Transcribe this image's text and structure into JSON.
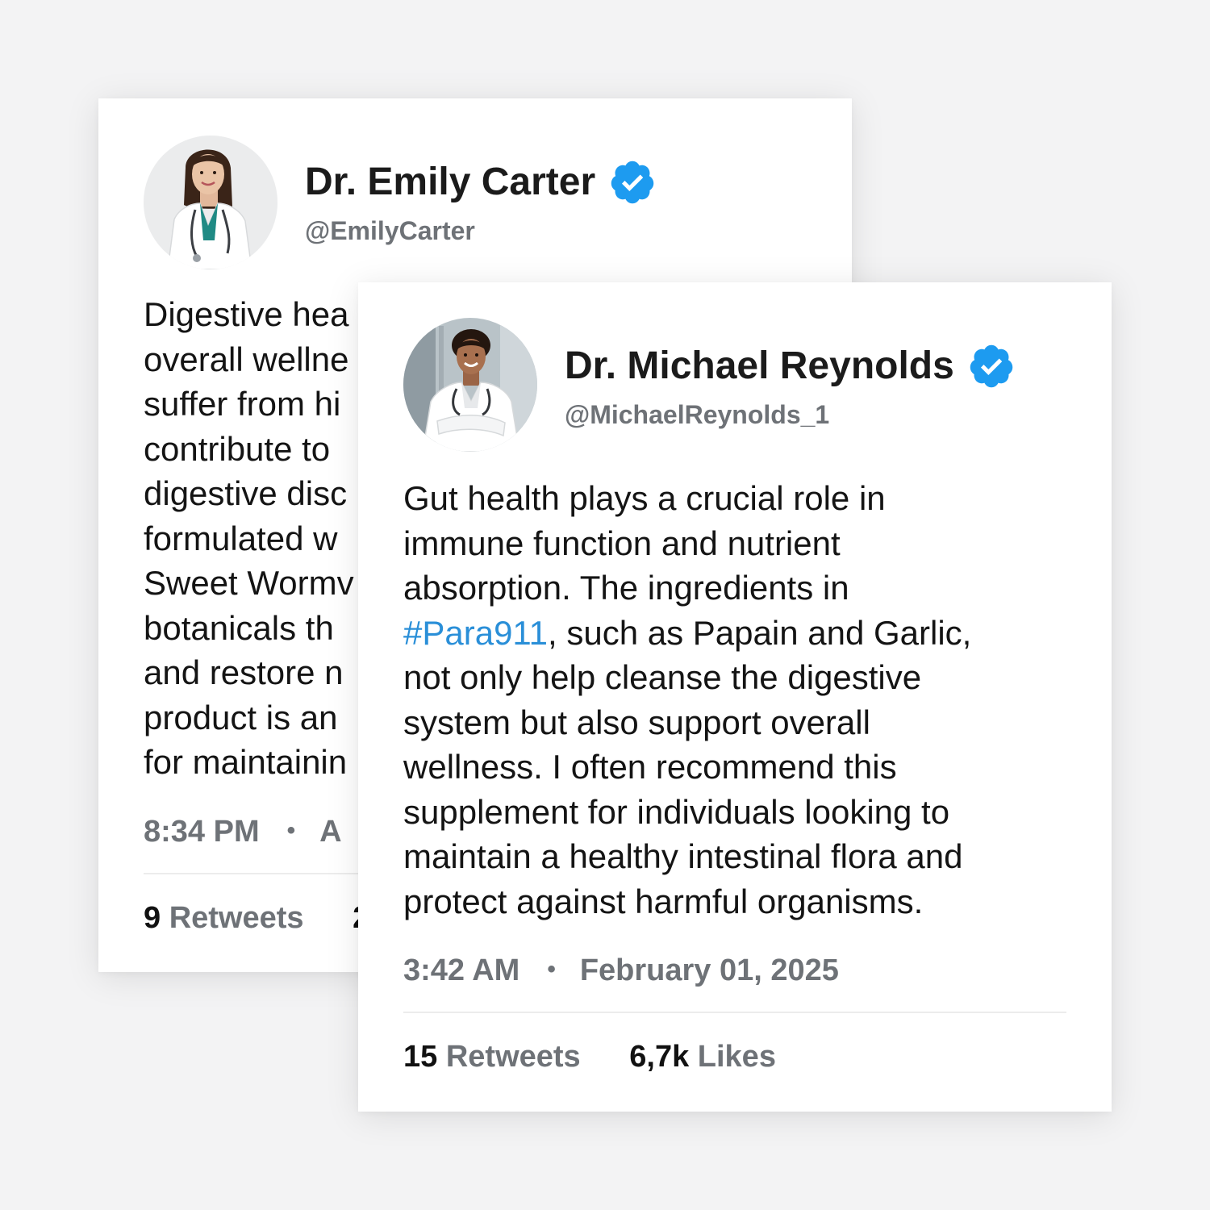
{
  "accent_color": "#2a8fd8",
  "verified_color": "#1d9bf0",
  "posts": [
    {
      "author": {
        "name": "Dr. Emily Carter",
        "handle": "@EmilyCarter",
        "verified": true,
        "avatar": "doctor-woman-avatar"
      },
      "body_lines": [
        "Digestive hea",
        "overall wellne",
        "suffer from hi",
        "contribute to",
        "digestive disc",
        "formulated w",
        "Sweet Wormv",
        "botanicals th",
        "and restore n",
        "product is an",
        "for maintainin"
      ],
      "time": "8:34 PM",
      "date": "A",
      "retweets": {
        "count": "9",
        "label": "Retweets"
      },
      "likes": {
        "count": "2",
        "label": ""
      }
    },
    {
      "author": {
        "name": "Dr. Michael Reynolds",
        "handle": "@MichaelReynolds_1",
        "verified": true,
        "avatar": "doctor-woman-avatar"
      },
      "body_lines": [
        "Gut health plays a crucial role in",
        "immune function and nutrient",
        "absorption. The ingredients in",
        ", such as Papain and Garlic,",
        "not only help cleanse the digestive",
        "system but also support overall",
        "wellness. I often recommend this",
        "supplement for individuals looking to",
        "maintain a healthy intestinal flora and",
        "protect against harmful organisms."
      ],
      "hashtag": "#Para911",
      "time": "3:42 AM",
      "date": "February 01, 2025",
      "retweets": {
        "count": "15",
        "label": "Retweets"
      },
      "likes": {
        "count": "6,7k",
        "label": "Likes"
      }
    }
  ]
}
